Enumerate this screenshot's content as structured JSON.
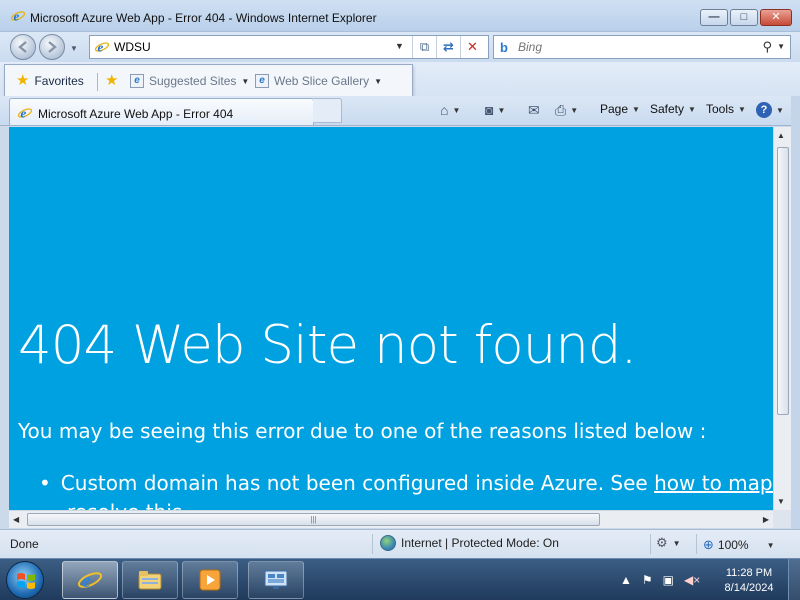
{
  "window": {
    "title": "Microsoft Azure Web App - Error 404 - Windows Internet Explorer",
    "minimize": "—",
    "maximize": "□",
    "close": "✕"
  },
  "navigation": {
    "back_glyph": "◀",
    "forward_glyph": "▶",
    "address_value": "WDSU",
    "dropdown_glyph": "▼",
    "compat_glyph": "⧉",
    "refresh_glyph": "⇄",
    "stop_glyph": "✕",
    "search_placeholder": "Bing",
    "search_logo": "b",
    "search_glyph": "⚲"
  },
  "favorites_bar": {
    "favorites_label": "Favorites",
    "suggested_sites_label": "Suggested Sites",
    "web_slice_gallery_label": "Web Slice Gallery"
  },
  "tab": {
    "label": "Microsoft Azure Web App - Error 404"
  },
  "command_bar": {
    "home_glyph": "⌂",
    "feeds_glyph": "◙",
    "mail_glyph": "✉",
    "print_glyph": "⎙",
    "page_label": "Page",
    "safety_label": "Safety",
    "tools_label": "Tools",
    "help_glyph": "?"
  },
  "content": {
    "headline": "404 Web Site not found.",
    "reason_intro": "You may be seeing this error due to one of the reasons listed below :",
    "bullet_text": "Custom domain has not been configured inside Azure. See ",
    "bullet_link": "how to map an existing domain",
    "bullet_continuation": "resolve this."
  },
  "status_bar": {
    "status_text": "Done",
    "zone_text": "Internet | Protected Mode: On",
    "zoom_glyph": "⊕",
    "zoom_level": "100%"
  },
  "taskbar": {
    "time": "11:28 PM",
    "date": "8/14/2024",
    "tray_arrow": "▲",
    "flag_glyph": "⚑",
    "network_glyph": "▣",
    "volume_glyph": "◀×"
  },
  "colors": {
    "page_background": "#00a1e0",
    "text": "#ffffff"
  }
}
